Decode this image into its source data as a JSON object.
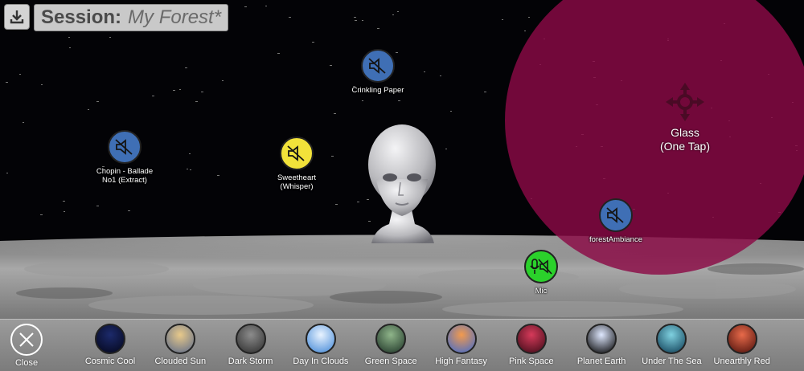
{
  "session": {
    "label": "Session:",
    "name": "My Forest*"
  },
  "icons": {
    "download": "download-icon",
    "muted": "speaker-muted-icon",
    "mic": "mic-muted-icon",
    "move": "move-arrows-icon",
    "close": "close-icon"
  },
  "sources": [
    {
      "id": "crinkling-paper",
      "label": "Crinkling Paper",
      "color": "#3f6fb5"
    },
    {
      "id": "chopin-ballade",
      "label": "Chopin - Ballade No1 (Extract)",
      "color": "#3f6fb5"
    },
    {
      "id": "sweetheart",
      "label": "Sweetheart (Whisper)",
      "color": "#f2e23a"
    },
    {
      "id": "forest-ambiance",
      "label": "forestAmbiance",
      "color": "#3f6fb5"
    },
    {
      "id": "mic",
      "label": "Mic",
      "color": "#2bd12b"
    }
  ],
  "glass": {
    "title": "Glass",
    "hint": "(One Tap)",
    "color": "#8b0a45"
  },
  "toolbar": {
    "close_label": "Close",
    "environments": [
      {
        "label": "Cosmic Cool",
        "c1": "#1c2a6b",
        "c2": "#04061a"
      },
      {
        "label": "Clouded Sun",
        "c1": "#e8c98a",
        "c2": "#5b6a8a"
      },
      {
        "label": "Dark Storm",
        "c1": "#8c8c8c",
        "c2": "#2c2c2c"
      },
      {
        "label": "Day In Clouds",
        "c1": "#e9f3ff",
        "c2": "#3f86d6"
      },
      {
        "label": "Green Space",
        "c1": "#8fb58a",
        "c2": "#1d3326"
      },
      {
        "label": "High Fantasy",
        "c1": "#f39a4d",
        "c2": "#3c6ad1"
      },
      {
        "label": "Pink Space",
        "c1": "#d63a5a",
        "c2": "#3b0a16"
      },
      {
        "label": "Planet Earth",
        "c1": "#dfe8ff",
        "c2": "#000000"
      },
      {
        "label": "Under The Sea",
        "c1": "#7fd1e0",
        "c2": "#0c3a52"
      },
      {
        "label": "Unearthly Red",
        "c1": "#e86a4a",
        "c2": "#4a0f0a"
      }
    ]
  }
}
